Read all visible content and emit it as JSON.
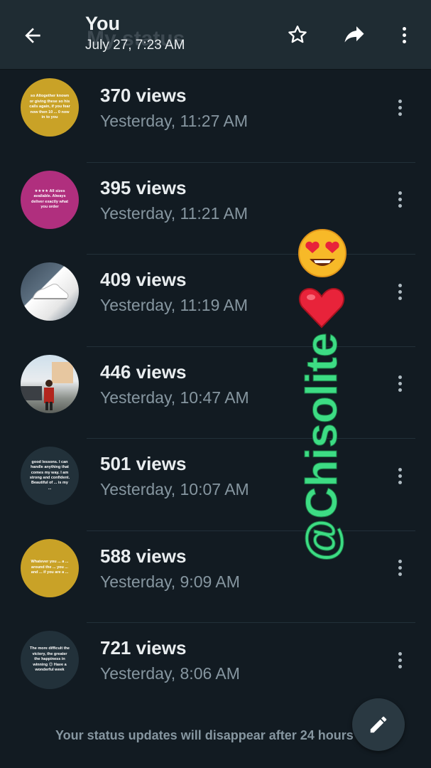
{
  "header": {
    "title": "You",
    "title_ghost": "My status",
    "subtitle": "July 27, 7:23 AM"
  },
  "statuses": [
    {
      "views": "370 views",
      "time": "Yesterday, 11:27 AM",
      "thumb_bg": "#c9a227",
      "thumb_text": "so Altogether known or giving these so his calls again, if you fear now then 10 ... 0 now in to you"
    },
    {
      "views": "395 views",
      "time": "Yesterday, 11:21 AM",
      "thumb_bg": "#b02f7e",
      "thumb_text": "★★★★ All sizes available. Always deliver exactly what you order"
    },
    {
      "views": "409 views",
      "time": "Yesterday, 11:19 AM",
      "thumb_bg": "#e8e8e8",
      "thumb_text": ""
    },
    {
      "views": "446 views",
      "time": "Yesterday, 10:47 AM",
      "thumb_bg": "#9fb7c6",
      "thumb_text": ""
    },
    {
      "views": "501 views",
      "time": "Yesterday, 10:07 AM",
      "thumb_bg": "#22313a",
      "thumb_text": "good lessons. I can handle anything that comes my way. I am strong and confident. Beautiful of ... is my ..."
    },
    {
      "views": "588 views",
      "time": "Yesterday, 9:09 AM",
      "thumb_bg": "#c9a227",
      "thumb_text": "Whatever you ... a ... around the ... you ... and ... if you are a ... "
    },
    {
      "views": "721 views",
      "time": "Yesterday, 8:06 AM",
      "thumb_bg": "#22313a",
      "thumb_text": "The more difficult the victory, the greater the happiness in winning 😊 Have a wonderful week"
    }
  ],
  "footer": {
    "note": "Your status updates will disappear after 24 hours"
  },
  "watermark": {
    "text": "@Chisolite"
  },
  "icons": {
    "back": "arrow-left-icon",
    "star": "star-outline-icon",
    "share": "share-arrow-icon",
    "menu": "more-vertical-icon",
    "fab": "pencil-icon"
  },
  "colors": {
    "background": "#121b22",
    "header": "#1f2c33",
    "fab": "#2a3942",
    "watermark": "#3ddc84"
  }
}
